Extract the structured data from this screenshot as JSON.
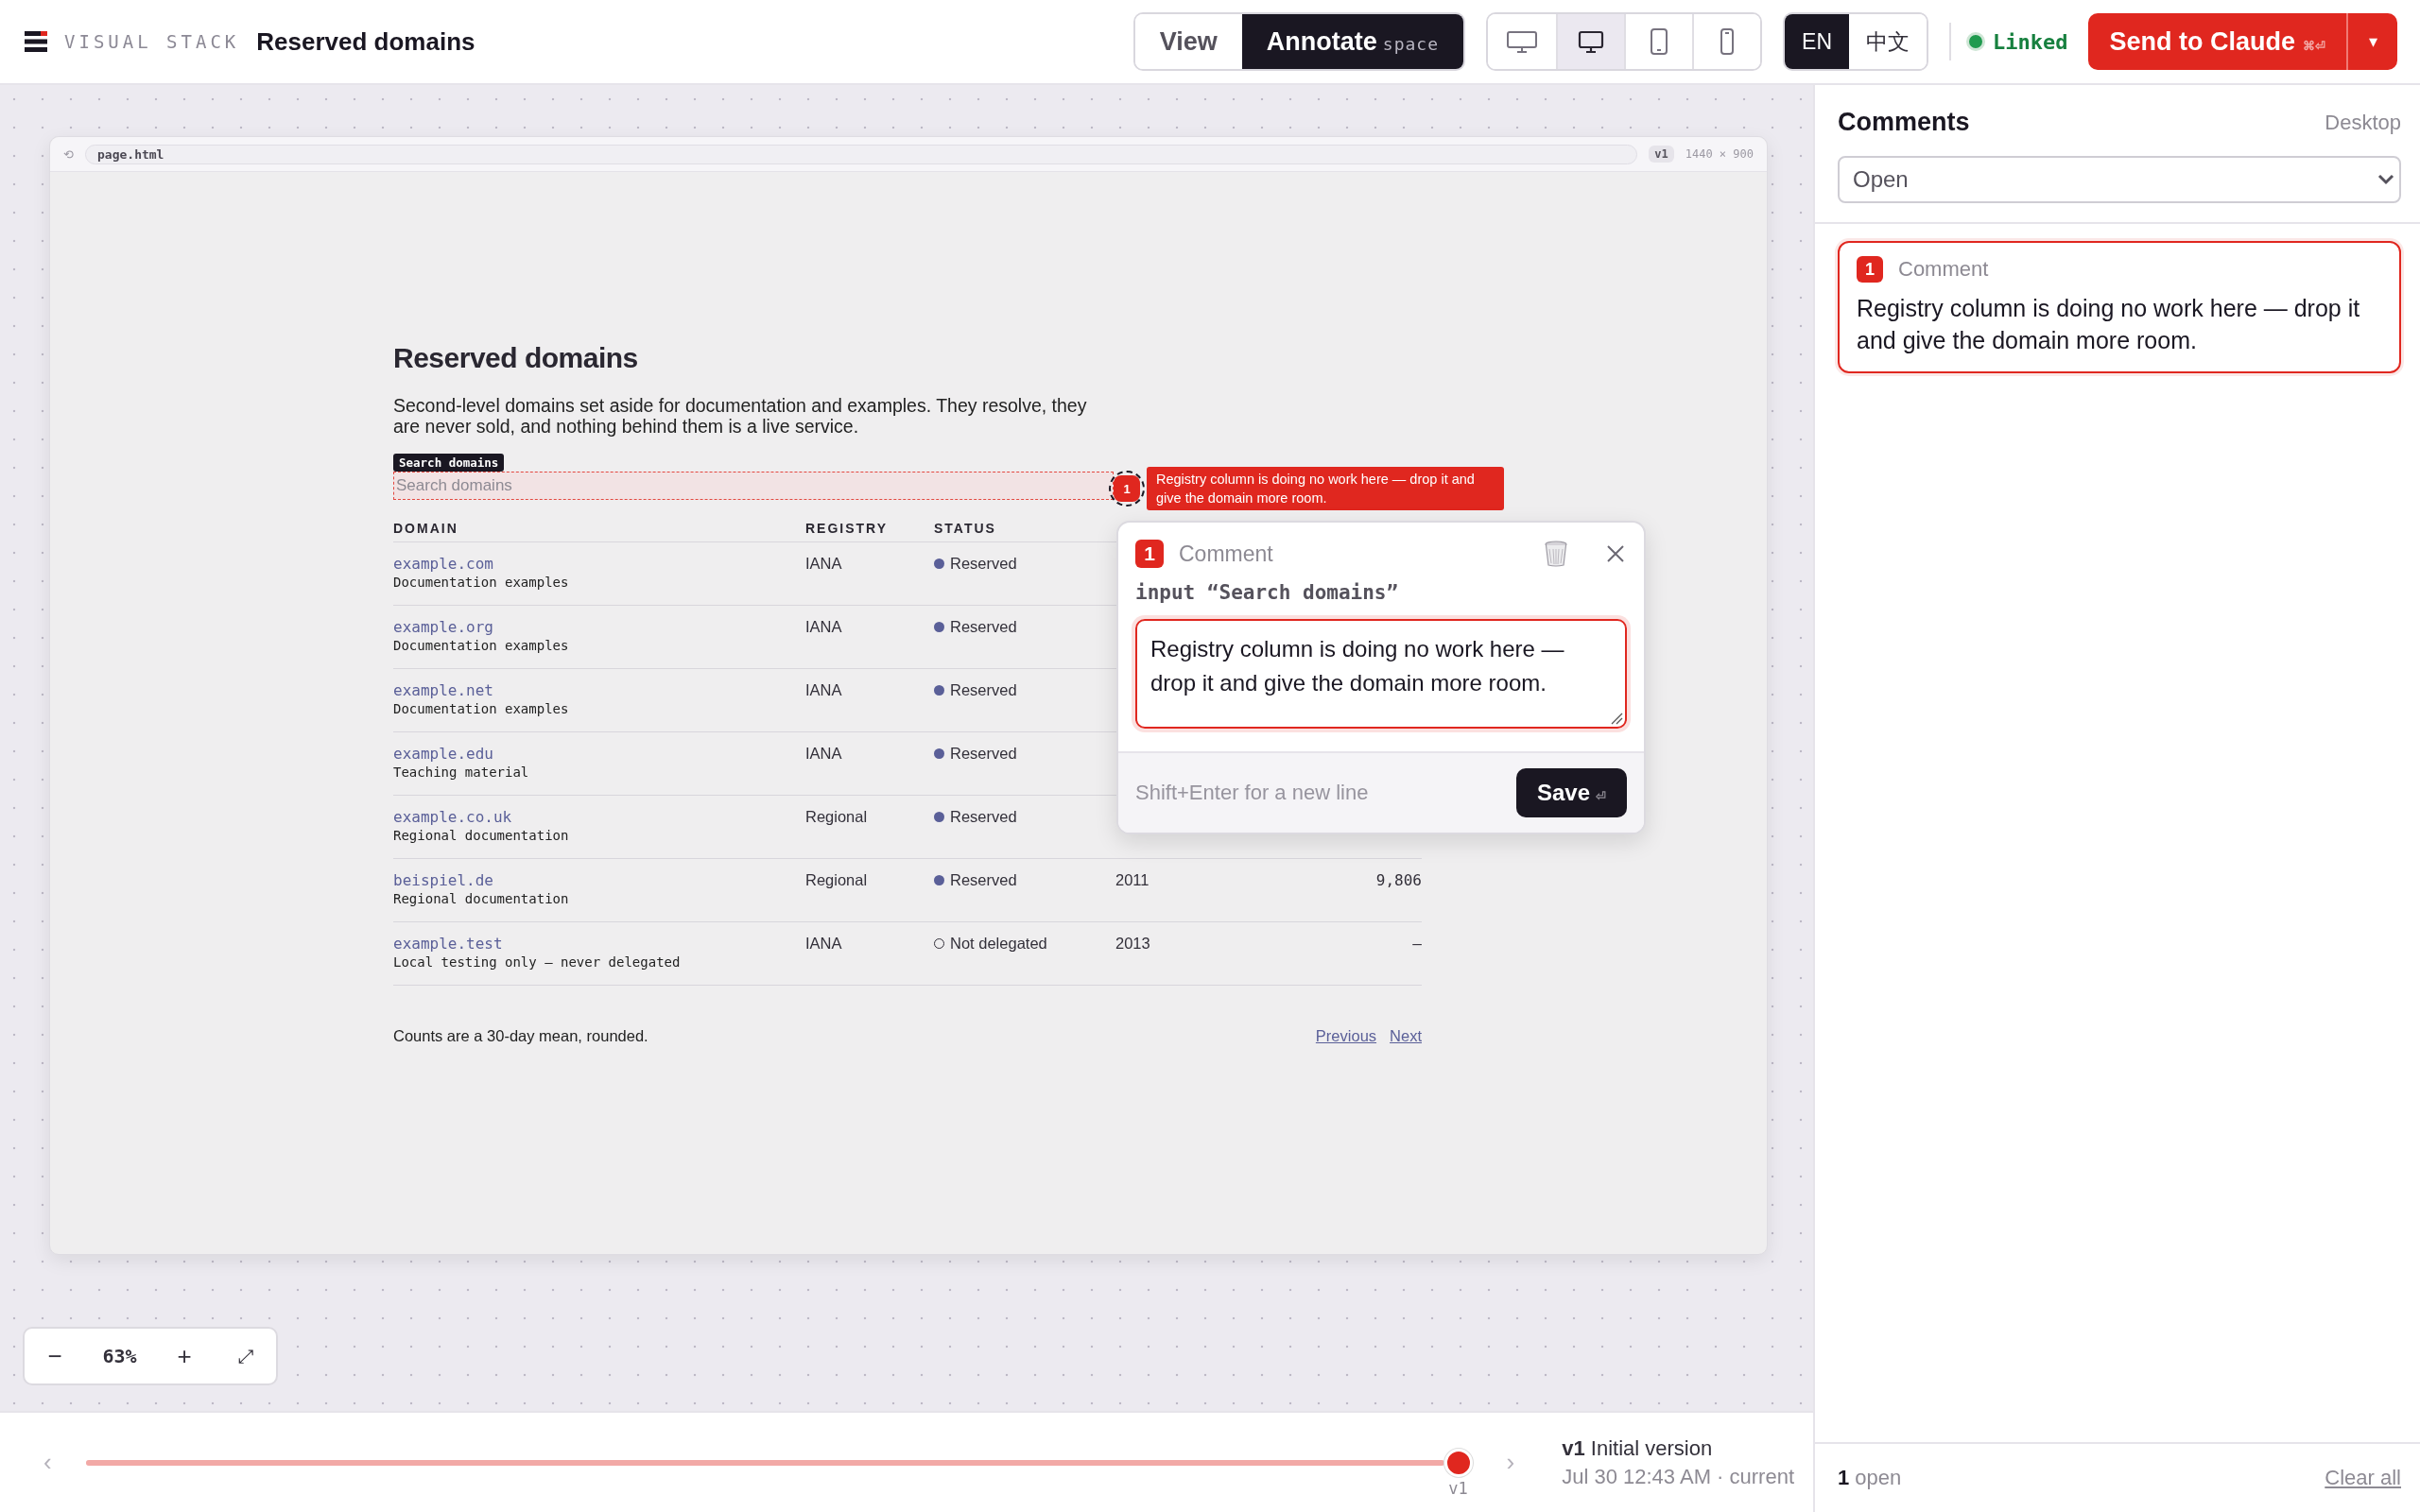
{
  "topbar": {
    "logo_text": "VISUAL STACK",
    "title": "Reserved domains",
    "modes": [
      {
        "label": "View",
        "selected": false
      },
      {
        "label": "Annotate",
        "hint": "space",
        "selected": true
      }
    ],
    "devices": [
      {
        "kind": "monitor",
        "selected": false
      },
      {
        "kind": "laptop",
        "selected": true
      },
      {
        "kind": "tablet",
        "selected": false
      },
      {
        "kind": "phone",
        "selected": false
      }
    ],
    "languages": [
      {
        "label": "EN",
        "selected": true
      },
      {
        "label": "中文",
        "selected": false
      }
    ],
    "link": {
      "label": "Linked",
      "on": true
    },
    "send": {
      "label": "Send to Claude",
      "shortcut": "⌘⏎",
      "caret": "▾"
    }
  },
  "browser": {
    "back": "⟲",
    "url": "page.html",
    "version": "v1",
    "size": "1440 × 900"
  },
  "page": {
    "title": "Reserved domains",
    "description": "Second-level domains set aside for documentation and examples. They resolve, they are never sold, and nothing behind them is a live service.",
    "search": {
      "label": "Search domains",
      "placeholder": "Search domains"
    },
    "table": {
      "columns": [
        "DOMAIN",
        "REGISTRY",
        "STATUS"
      ],
      "rows": [
        {
          "domain": "example.com",
          "note": "Documentation examples",
          "registry": "IANA",
          "status": "Reserved",
          "filled": true
        },
        {
          "domain": "example.org",
          "note": "Documentation examples",
          "registry": "IANA",
          "status": "Reserved",
          "filled": true
        },
        {
          "domain": "example.net",
          "note": "Documentation examples",
          "registry": "IANA",
          "status": "Reserved",
          "filled": true
        },
        {
          "domain": "example.edu",
          "note": "Teaching material",
          "registry": "IANA",
          "status": "Reserved",
          "filled": true
        },
        {
          "domain": "example.co.uk",
          "note": "Regional documentation",
          "registry": "Regional",
          "status": "Reserved",
          "filled": true
        },
        {
          "domain": "beispiel.de",
          "note": "Regional documentation",
          "registry": "Regional",
          "status": "Reserved",
          "filled": true,
          "column_4": "2011",
          "column_5": "9,806"
        },
        {
          "domain": "example.test",
          "note": "Local testing only — never delegated",
          "registry": "IANA",
          "status": "Not delegated",
          "filled": false,
          "column_4": "2013",
          "column_5": "–"
        }
      ]
    },
    "footnote": "Counts are a 30-day mean, rounded.",
    "pager": [
      "Previous",
      "Next"
    ]
  },
  "annotation": {
    "number": "1",
    "text": "Registry column is doing no work here — drop it and give the domain more room."
  },
  "popup": {
    "number": "1",
    "title": "Comment",
    "target": "input “Search domains”",
    "value": "Registry column is doing no work here — drop it and give the domain more room.",
    "hint": "Shift+Enter for a new line",
    "save": "Save",
    "save_key": "⏎"
  },
  "zoom": {
    "minus": "−",
    "value": "63%",
    "plus": "+",
    "fit": "⤢"
  },
  "timeline": {
    "prev": "‹",
    "next": "›",
    "marker": "v1",
    "level": 1,
    "version": "v1",
    "version_title": "Initial version",
    "date": "Jul 30 12:43 AM · current"
  },
  "sidebar": {
    "title": "Comments",
    "scope": "Desktop",
    "filter": "Open",
    "comments": [
      {
        "number": "1",
        "title": "Comment",
        "text": "Registry column is doing no work here — drop it and give the domain more room.",
        "selected": true
      }
    ],
    "count": "1",
    "count_label": "open",
    "clear": "Clear all"
  }
}
